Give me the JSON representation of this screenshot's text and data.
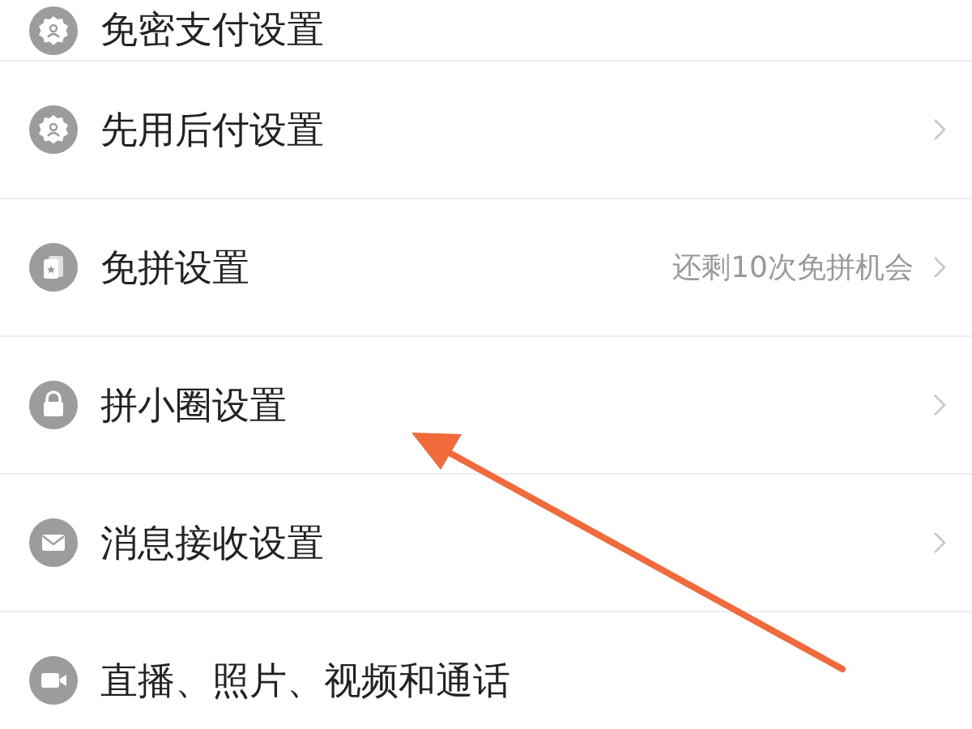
{
  "settings": [
    {
      "label": "免密支付设置",
      "chevron": false
    },
    {
      "label": "先用后付设置",
      "chevron": true
    },
    {
      "label": "免拼设置",
      "hint": "还剩10次免拼机会",
      "chevron": true
    },
    {
      "label": "拼小圈设置",
      "chevron": true
    },
    {
      "label": "消息接收设置",
      "chevron": true
    },
    {
      "label": "直播、照片、视频和通话",
      "chevron": false
    }
  ]
}
